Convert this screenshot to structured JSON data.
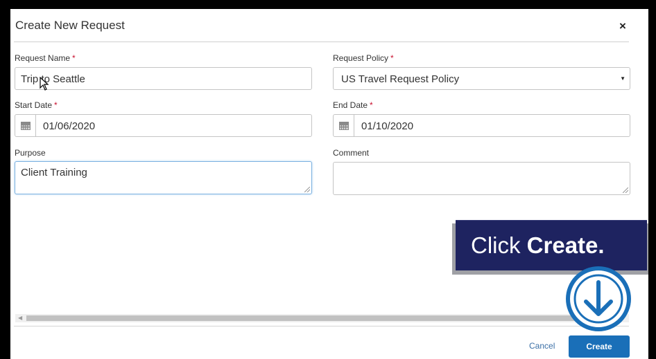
{
  "dialog": {
    "title": "Create New Request",
    "close_label": "×"
  },
  "fields": {
    "request_name": {
      "label": "Request Name",
      "required_mark": "*",
      "value": "Trip to Seattle"
    },
    "request_policy": {
      "label": "Request Policy",
      "required_mark": "*",
      "value": "US Travel Request Policy"
    },
    "start_date": {
      "label": "Start Date",
      "required_mark": "*",
      "value": "01/06/2020"
    },
    "end_date": {
      "label": "End Date",
      "required_mark": "*",
      "value": "01/10/2020"
    },
    "purpose": {
      "label": "Purpose",
      "value": "Client Training"
    },
    "comment": {
      "label": "Comment",
      "value": ""
    }
  },
  "footer": {
    "cancel_label": "Cancel",
    "create_label": "Create"
  },
  "callout": {
    "prefix": "Click ",
    "emphasis": "Create."
  },
  "colors": {
    "primary_button": "#1a6fb8",
    "callout_bg": "#1e2360",
    "required": "#c8102e",
    "link": "#3b6fa6"
  }
}
